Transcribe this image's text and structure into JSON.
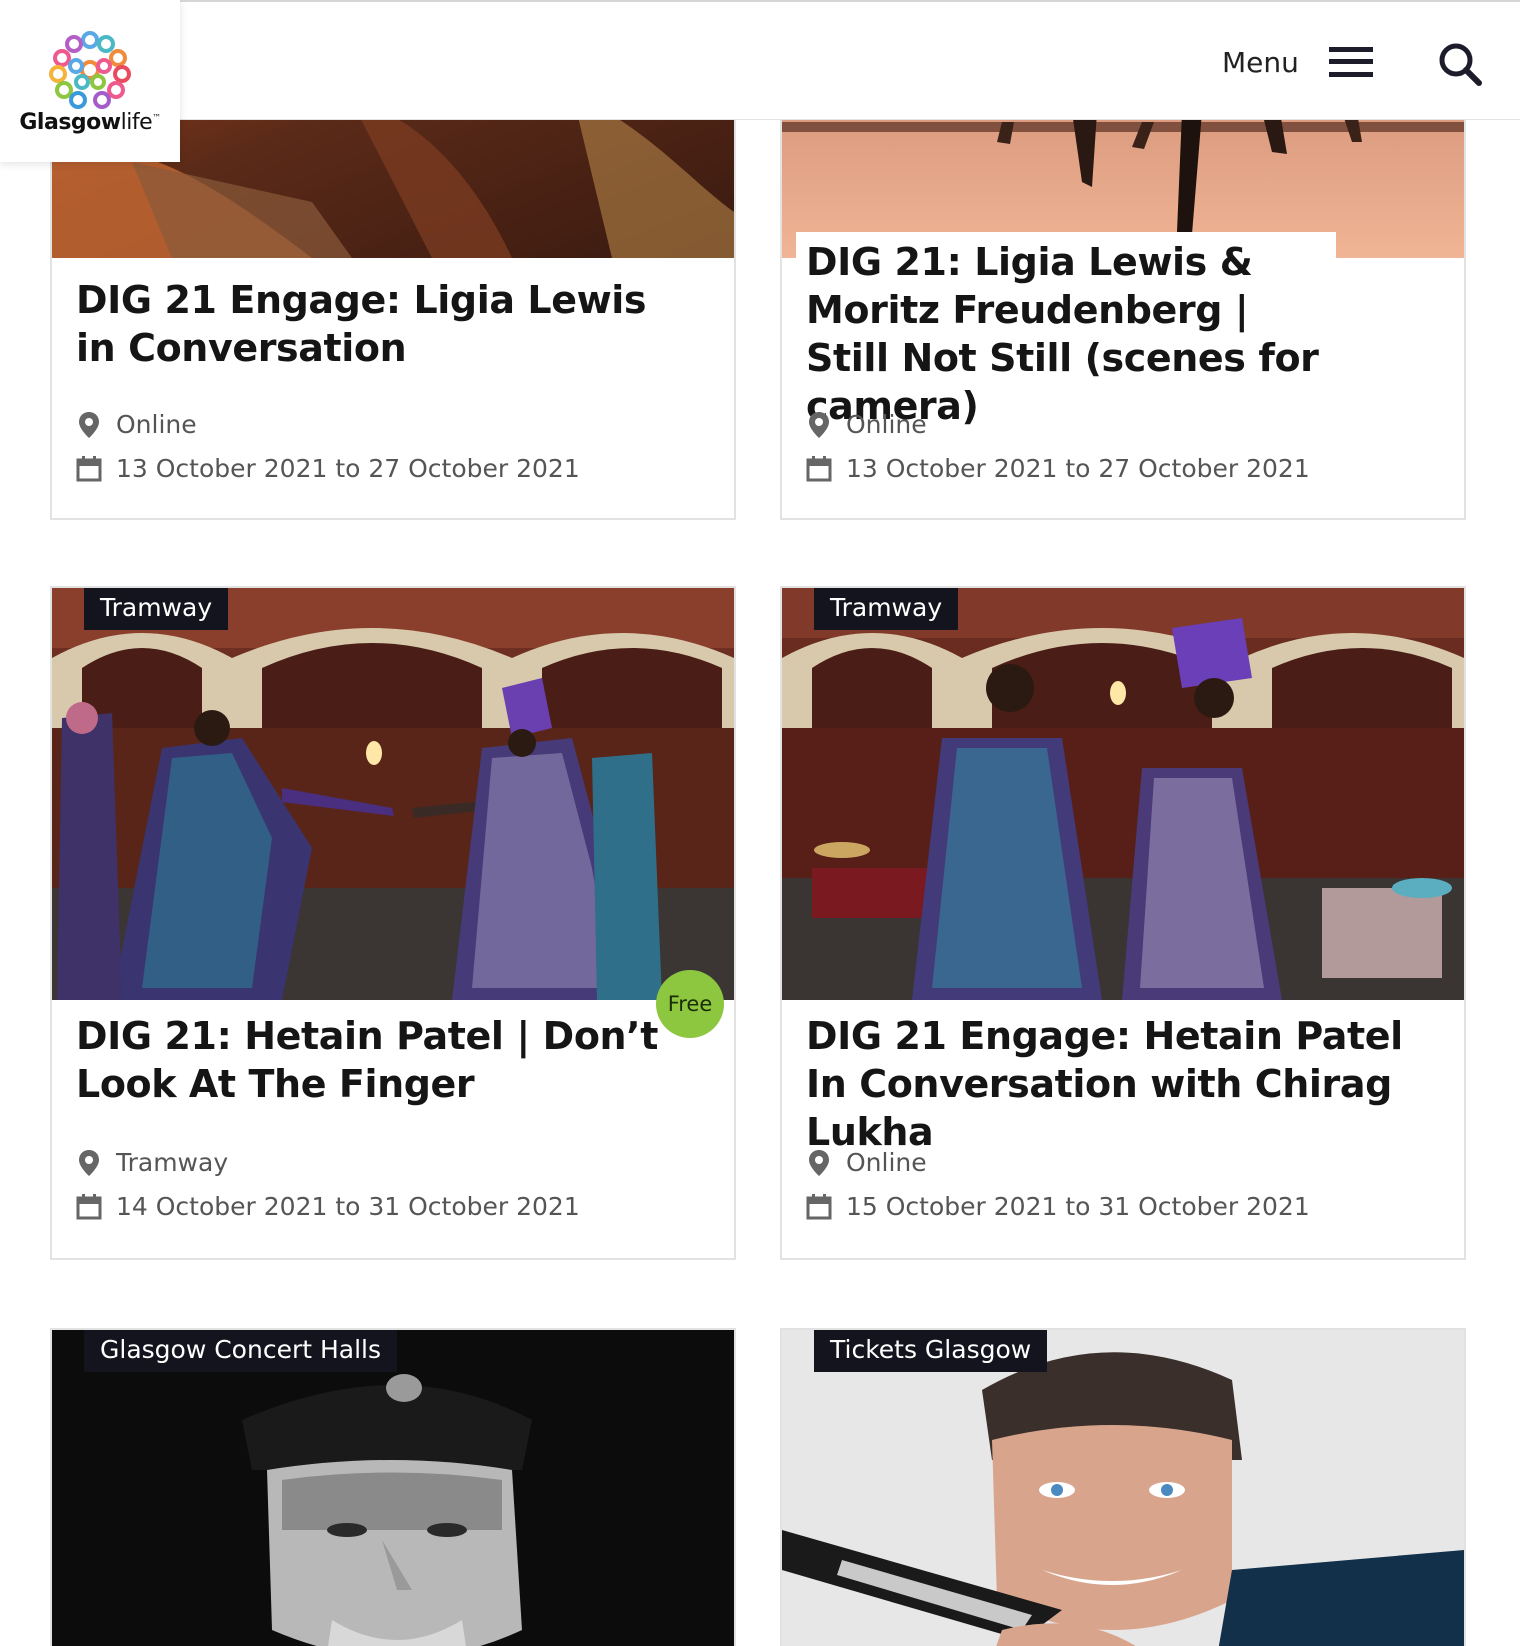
{
  "header": {
    "logo_text": "Glasgow",
    "logo_text_suffix": "life",
    "logo_tm": "™",
    "menu_label": "Menu",
    "menu_icon": "hamburger-icon",
    "search_icon": "search-icon"
  },
  "cards": [
    {
      "title": "DIG 21 Engage: Ligia Lewis in Conversation",
      "location": "Online",
      "dates": "13 October 2021 to 27 October 2021"
    },
    {
      "title": "DIG 21: Ligia Lewis & Moritz Freudenberg | Still Not Still (scenes for camera)",
      "location": "Online",
      "dates": "13 October 2021 to 27 October 2021"
    },
    {
      "venue": "Tramway",
      "badge": "Free",
      "title": "DIG 21: Hetain Patel | Don’t Look At The Finger",
      "location": "Tramway",
      "dates": "14 October 2021 to 31 October 2021"
    },
    {
      "venue": "Tramway",
      "title": "DIG 21 Engage: Hetain Patel In Conversation with Chirag Lukha",
      "location": "Online",
      "dates": "15 October 2021 to 31 October 2021"
    },
    {
      "venue": "Glasgow Concert Halls"
    },
    {
      "venue": "Tickets Glasgow"
    }
  ],
  "colors": {
    "free_badge": "#8dc63f",
    "venue_tag": "#14141e",
    "card_border": "#e2e2e2",
    "meta_text": "#555555"
  }
}
